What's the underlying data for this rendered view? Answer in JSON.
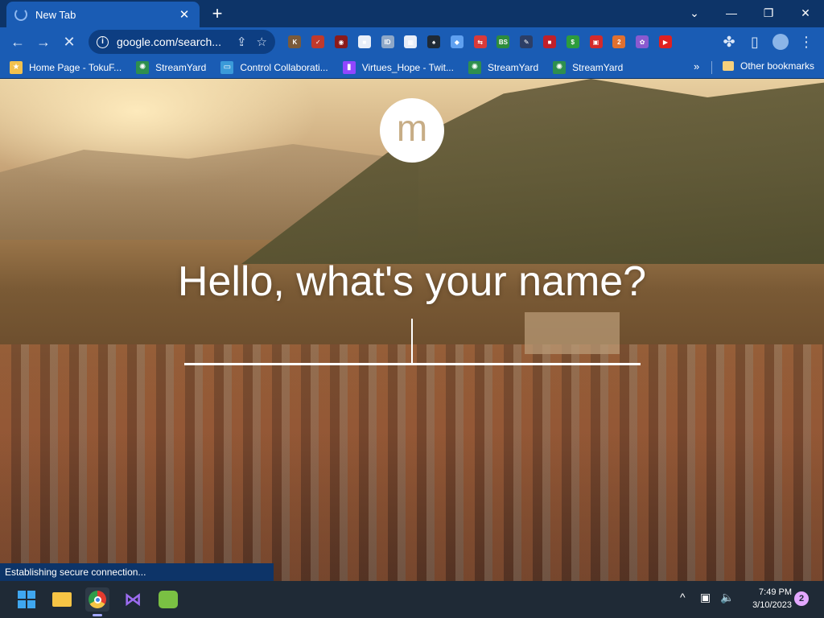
{
  "tab": {
    "title": "New Tab",
    "close": "✕"
  },
  "newtab": "+",
  "window_controls": {
    "minimize": "—",
    "restore": "❐",
    "close": "✕",
    "menu": "⌄"
  },
  "toolbar": {
    "back": "←",
    "forward": "→",
    "stop": "✕",
    "url": "google.com/search...",
    "share_icon": "share-icon",
    "star_icon": "☆",
    "puzzle": "✤",
    "sidebar": "▯",
    "menu": "⋮"
  },
  "extensions": [
    {
      "name": "k",
      "text": "K",
      "color": "#7a5a3a"
    },
    {
      "name": "red-check",
      "text": "✓",
      "color": "#c0392b"
    },
    {
      "name": "dark-red",
      "text": "◉",
      "color": "#8b1a1a"
    },
    {
      "name": "white-card",
      "text": "■",
      "color": "#e8eef8"
    },
    {
      "name": "id",
      "text": "ID",
      "color": "#8fa8c8"
    },
    {
      "name": "grid",
      "text": "▦",
      "color": "#e8eef8"
    },
    {
      "name": "hat",
      "text": "♠",
      "color": "#1f2a36"
    },
    {
      "name": "cube",
      "text": "◆",
      "color": "#5fa0f0"
    },
    {
      "name": "arrows",
      "text": "⇆",
      "color": "#d93a3a"
    },
    {
      "name": "bs",
      "text": "BS",
      "color": "#2d8c3c"
    },
    {
      "name": "pen",
      "text": "✎",
      "color": "#2c3e66"
    },
    {
      "name": "red-box",
      "text": "■",
      "color": "#c0202a"
    },
    {
      "name": "dollar",
      "text": "$",
      "color": "#2d9c3c"
    },
    {
      "name": "red-square",
      "text": "▣",
      "color": "#d42a2a"
    },
    {
      "name": "badge",
      "text": "2",
      "color": "#e07030"
    },
    {
      "name": "purple",
      "text": "✿",
      "color": "#8a5ad0"
    },
    {
      "name": "youtube",
      "text": "▶",
      "color": "#e02020"
    }
  ],
  "bookmarks": [
    {
      "label": "Home Page - TokuF...",
      "icon": "★",
      "color": "#f2c14e"
    },
    {
      "label": "StreamYard",
      "icon": "✺",
      "color": "#2e8f4e"
    },
    {
      "label": "Control Collaborati...",
      "icon": "▭",
      "color": "#3a9ad9"
    },
    {
      "label": "Virtues_Hope - Twit...",
      "icon": "▮",
      "color": "#9146ff"
    },
    {
      "label": "StreamYard",
      "icon": "✺",
      "color": "#2e8f4e"
    },
    {
      "label": "StreamYard",
      "icon": "✺",
      "color": "#2e8f4e"
    }
  ],
  "bookmarks_more": "»",
  "other_bookmarks": "Other bookmarks",
  "main": {
    "avatar_letter": "m",
    "greeting": "Hello, what's your name?",
    "input_value": ""
  },
  "status": "Establishing secure connection...",
  "taskbar": {
    "time": "7:49 PM",
    "date": "3/10/2023",
    "notifications": "2",
    "tray_chevron": "^",
    "tray_display": "▣",
    "tray_volume": "🔈"
  }
}
